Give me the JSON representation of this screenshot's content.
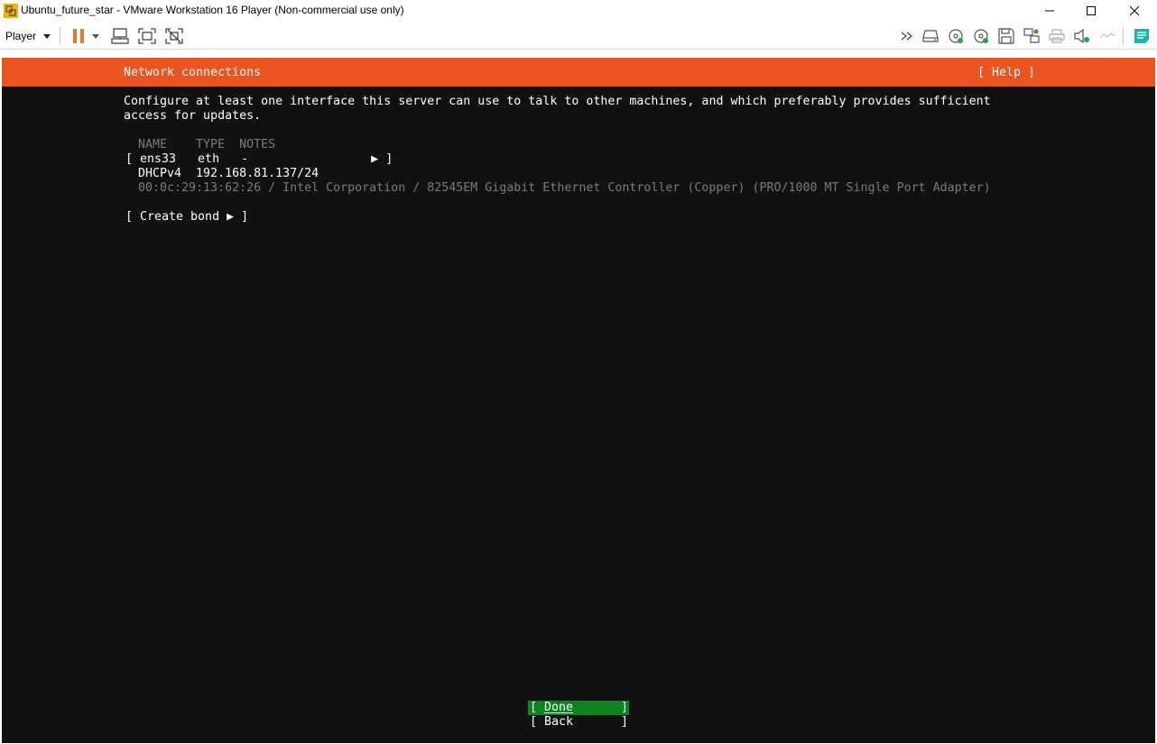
{
  "window": {
    "title": "Ubuntu_future_star - VMware Workstation 16 Player (Non-commercial use only)"
  },
  "toolbar": {
    "player_label": "Player",
    "icons": [
      "pause-icon",
      "dropdown-icon",
      "send-ctrl-alt-del-icon",
      "fullscreen-icon",
      "unity-icon",
      "more-icon",
      "hard-disk-icon",
      "cd-dvd-icon",
      "cd-dvd-2-icon",
      "floppy-icon",
      "network-adapter-icon",
      "printer-icon",
      "sound-card-icon",
      "usb-icon",
      "message-log-icon"
    ],
    "accent": "#e8772e"
  },
  "screen": {
    "colors": {
      "header": "#e95420",
      "background": "#111111",
      "selected_button": "#0e8420"
    },
    "header_title": "Network connections",
    "help": "[ Help ]",
    "intro_line1": "Configure at least one interface this server can use to talk to other machines, and which preferably provides sufficient",
    "intro_line2": "access for updates.",
    "table_header": "NAME    TYPE  NOTES",
    "interface_row": "[ ens33   eth   -                 ▶ ]",
    "dhcp_line": "DHCPv4  192.168.81.137/24",
    "device_line": "00:0c:29:13:62:26 / Intel Corporation / 82545EM Gigabit Ethernet Controller (Copper) (PRO/1000 MT Single Port Adapter)",
    "create_bond": "[ Create bond ▶ ]",
    "done": {
      "open": "[",
      "label": "Done",
      "close": "]"
    },
    "back": {
      "open": "[",
      "label": "Back",
      "close": "]"
    }
  }
}
